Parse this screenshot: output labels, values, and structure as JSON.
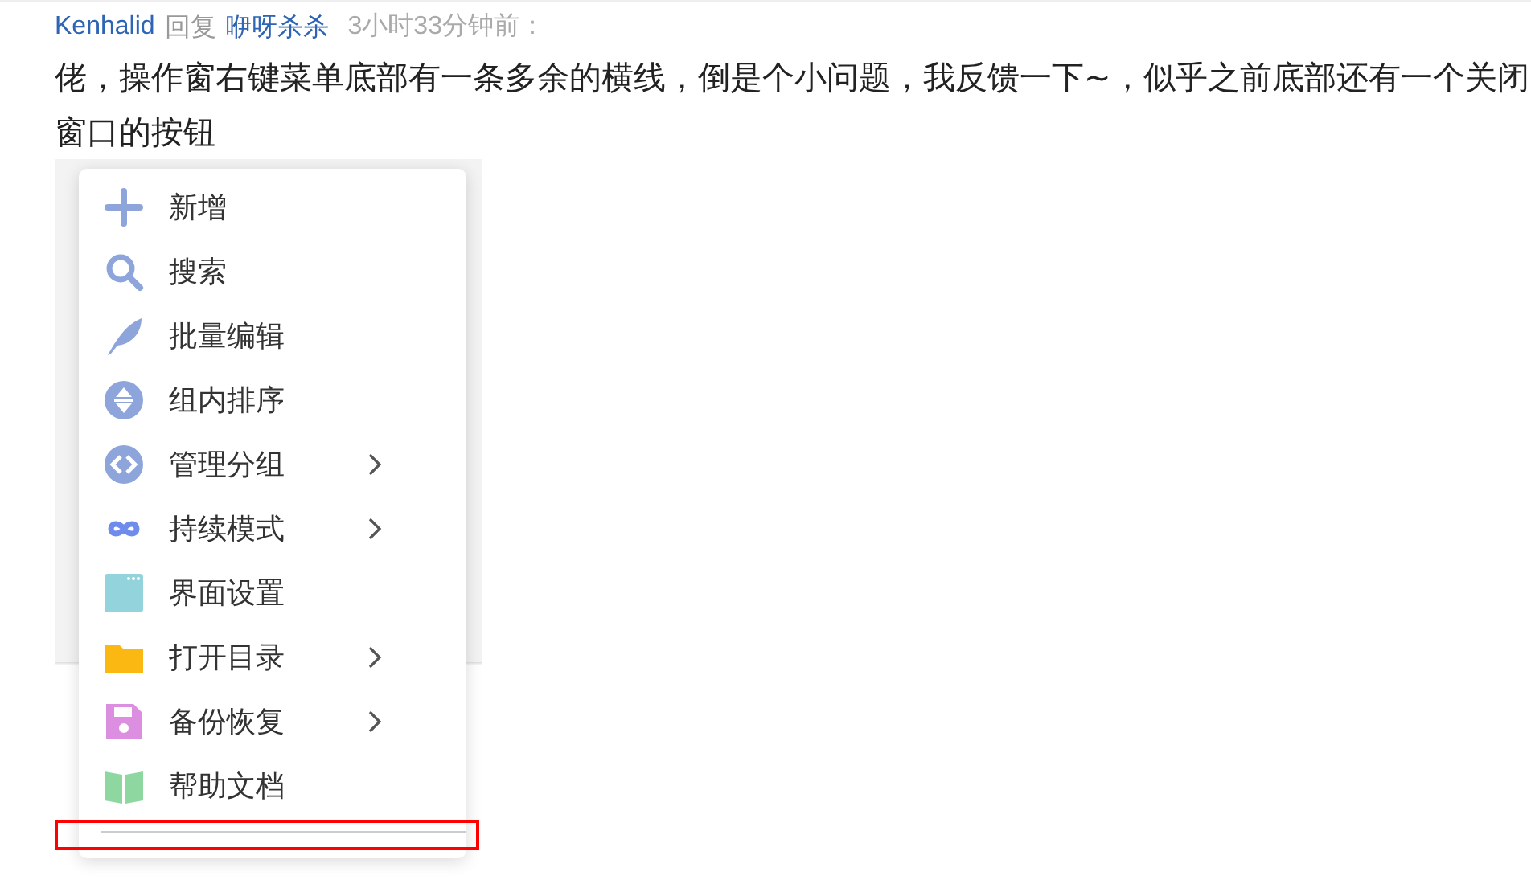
{
  "comment": {
    "author": "Kenhalid",
    "reply_word": "回复",
    "reply_to": "咿呀杀杀",
    "time": "3小时33分钟前：",
    "text": "佬，操作窗右键菜单底部有一条多余的横线，倒是个小问题，我反馈一下~，似乎之前底部还有一个关闭窗口的按钮"
  },
  "menu": {
    "items": [
      {
        "label": "新增",
        "has_submenu": false
      },
      {
        "label": "搜索",
        "has_submenu": false
      },
      {
        "label": "批量编辑",
        "has_submenu": false
      },
      {
        "label": "组内排序",
        "has_submenu": false
      },
      {
        "label": "管理分组",
        "has_submenu": true
      },
      {
        "label": "持续模式",
        "has_submenu": true
      },
      {
        "label": "界面设置",
        "has_submenu": false
      },
      {
        "label": "打开目录",
        "has_submenu": true
      },
      {
        "label": "备份恢复",
        "has_submenu": true
      },
      {
        "label": "帮助文档",
        "has_submenu": false
      }
    ]
  }
}
